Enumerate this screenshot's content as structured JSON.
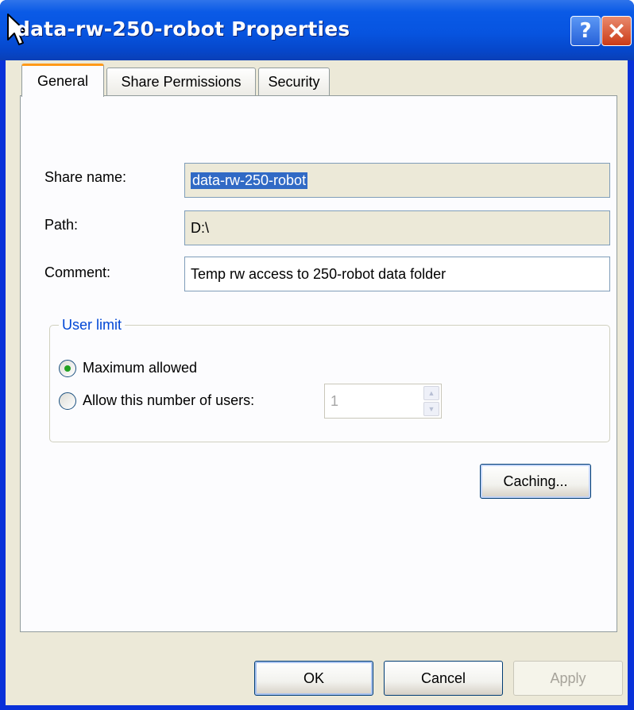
{
  "window": {
    "title": "data-rw-250-robot Properties",
    "help_glyph": "?",
    "close_glyph": "✕"
  },
  "tabs": [
    {
      "label": "General",
      "active": true
    },
    {
      "label": "Share Permissions",
      "active": false
    },
    {
      "label": "Security",
      "active": false
    }
  ],
  "form": {
    "share_name_label": "Share name:",
    "share_name_value": "data-rw-250-robot",
    "path_label": "Path:",
    "path_value": "D:\\",
    "comment_label": "Comment:",
    "comment_value": "Temp rw access to 250-robot data folder"
  },
  "user_limit": {
    "legend": "User limit",
    "option_max_label": "Maximum allowed",
    "option_max_selected": true,
    "option_number_label": "Allow this number of users:",
    "option_number_selected": false,
    "user_count_value": "1"
  },
  "buttons": {
    "caching": "Caching...",
    "ok": "OK",
    "cancel": "Cancel",
    "apply": "Apply"
  },
  "colors": {
    "title_bar": "#0754e0",
    "dialog_face": "#ece9d8",
    "selection": "#316ac5",
    "group_legend": "#0046d5"
  }
}
